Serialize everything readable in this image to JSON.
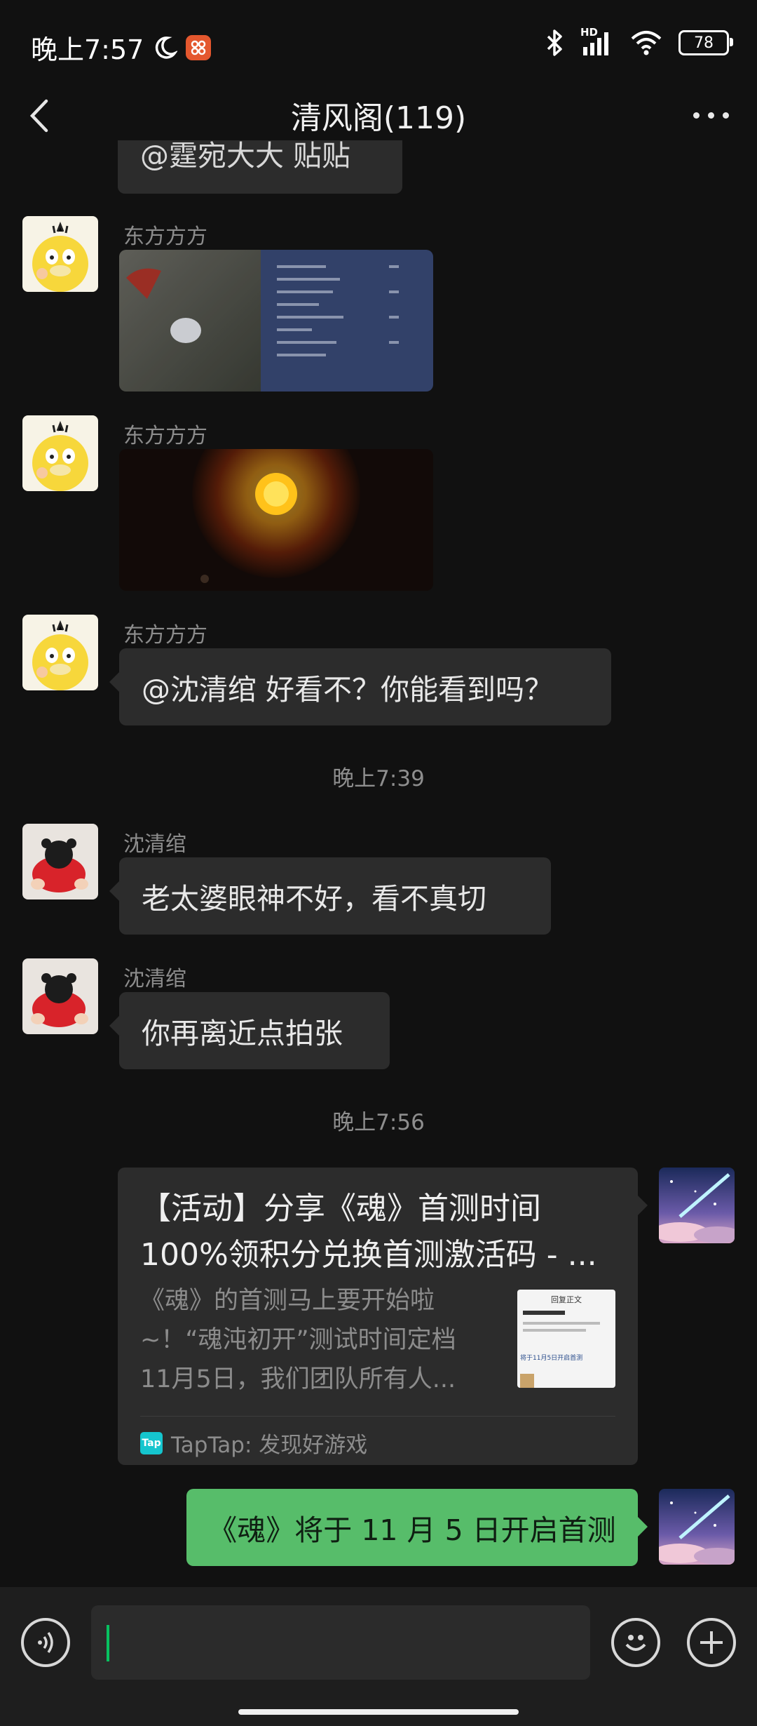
{
  "status_bar": {
    "time": "晚上7:57",
    "battery": "78",
    "hd_label": "HD"
  },
  "header": {
    "title": "清风阁(119)"
  },
  "messages": {
    "partial_text": "@霆宛大大 贴贴",
    "sender_1": "东方方方",
    "sender_2": "东方方方",
    "sender_3": "东方方方",
    "text_3": "@沈清绾  好看不？你能看到吗？",
    "time_1": "晚上7:39",
    "sender_4": "沈清绾",
    "text_4": "老太婆眼神不好，看不真切",
    "sender_5": "沈清绾",
    "text_5": "你再离近点拍张",
    "time_2": "晚上7:56",
    "link_card": {
      "title": "【活动】分享《魂》首测时间100%领积分兑换首测激活码 - ...",
      "description": "《魂》的首测马上要开始啦~！“魂沌初开”测试时间定档11月5日，我们团队所有人...",
      "source_icon": "Tap",
      "source": "TapTap: 发现好游戏",
      "thumb_title": "回复正文",
      "thumb_line": "将于11月5日开启首测"
    },
    "my_text": "《魂》将于 11 月 5 日开启首测"
  },
  "colors": {
    "background": "#111111",
    "bubble": "#2c2c2c",
    "my_bubble": "#57bd6a",
    "cursor": "#07c160"
  }
}
